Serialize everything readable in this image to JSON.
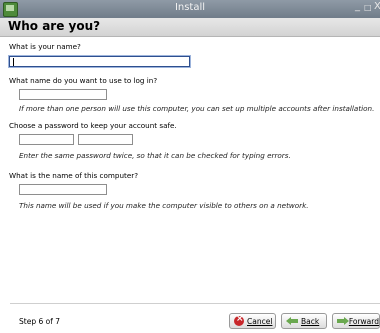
{
  "window": {
    "title": "Install",
    "minimize": "_",
    "maximize": "□",
    "close": "X"
  },
  "header": {
    "title": "Who are you?"
  },
  "form": {
    "name_label": "What is your name?",
    "name_value": "",
    "login_label": "What name do you want to use to log in?",
    "login_value": "",
    "login_hint": "If more than one person will use this computer, you can set up multiple accounts after installation.",
    "password_label": "Choose a password to keep your account safe.",
    "password_hint": "Enter the same password twice, so that it can be checked for typing errors.",
    "computer_label": "What is the name of this computer?",
    "computer_value": "",
    "computer_hint": "This name will be used if you make the computer visible to others on a network."
  },
  "footer": {
    "step": "Step 6 of 7",
    "cancel_label": "Cancel",
    "back_label": "Back",
    "forward_label": "Forward"
  },
  "colors": {
    "titlebar": "#7f8b97",
    "cancel_icon": "#c8272b",
    "arrow_icon": "#6aa84f"
  }
}
